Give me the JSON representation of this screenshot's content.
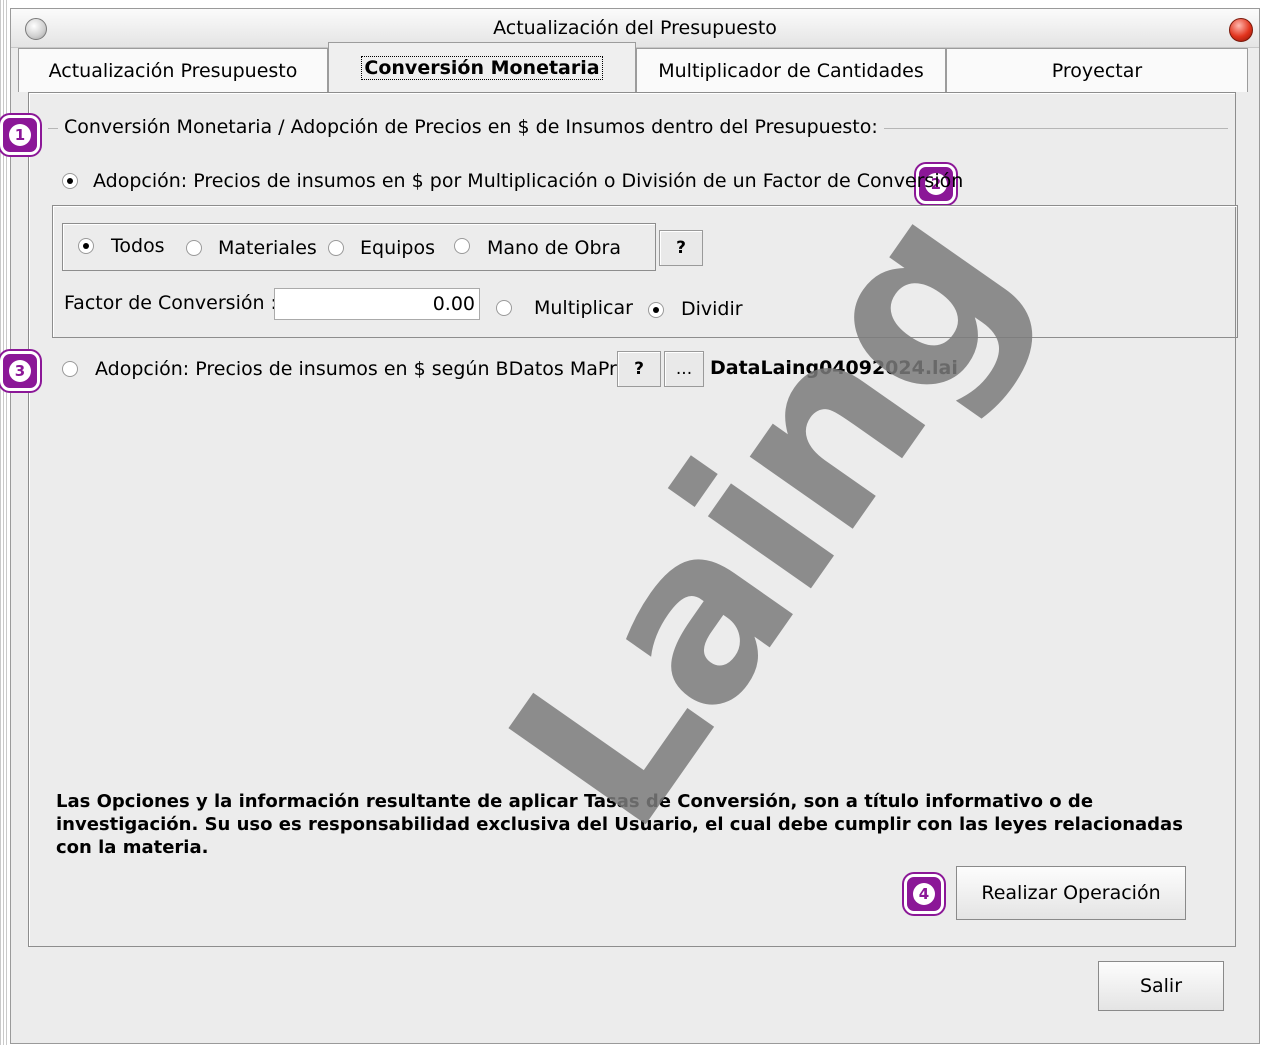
{
  "window": {
    "title": "Actualización del Presupuesto"
  },
  "tabs": [
    {
      "label": "Actualización Presupuesto"
    },
    {
      "label": "Conversión Monetaria"
    },
    {
      "label": "Multiplicador de Cantidades"
    },
    {
      "label": "Proyectar"
    }
  ],
  "group": {
    "legend": "Conversión Monetaria / Adopción de Precios en $ de Insumos dentro del Presupuesto:"
  },
  "option1": {
    "label": "Adopción: Precios de insumos en $ por Multiplicación o División de un Factor de Conversión",
    "checked": true
  },
  "filters": {
    "todos": "Todos",
    "materiales": "Materiales",
    "equipos": "Equipos",
    "mano_obra": "Mano de Obra",
    "selected": "Todos",
    "help": "?"
  },
  "factor": {
    "label": "Factor de Conversión :",
    "value": "0.00",
    "multiplicar": "Multiplicar",
    "dividir": "Dividir",
    "selected": "Dividir"
  },
  "option3": {
    "label": "Adopción: Precios de insumos en $ según BDatos MaPreX",
    "help": "?",
    "browse": "...",
    "file": "DataLaing04092024.lai",
    "checked": false
  },
  "badges": [
    "1",
    "2",
    "3",
    "4"
  ],
  "disclaimer": "Las Opciones y la información resultante de aplicar Tasas de Conversión, son a título informativo o de investigación. Su uso es responsabilidad exclusiva del Usuario, el cual debe cumplir con las leyes relacionadas con la materia.",
  "buttons": {
    "realizar": "Realizar Operación",
    "salir": "Salir"
  },
  "watermark": "Laing",
  "colors": {
    "badge": "#8b1797",
    "close": "#e2341d"
  }
}
